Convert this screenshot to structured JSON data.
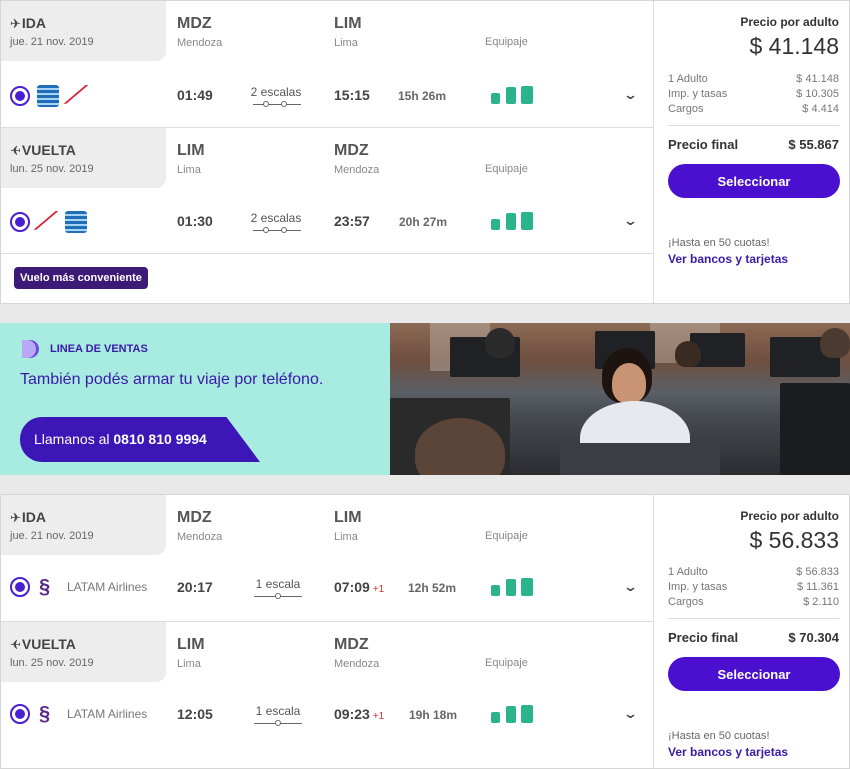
{
  "results": [
    {
      "legs": [
        {
          "direction": "IDA",
          "date": "jue. 21 nov. 2019",
          "origin_code": "MDZ",
          "origin_city": "Mendoza",
          "dest_code": "LIM",
          "dest_city": "Lima",
          "baggage_label": "Equipaje",
          "depart": "01:49",
          "stops": "2 escalas",
          "arrive": "15:15",
          "arrive_plus": "",
          "duration": "15h 26m",
          "airline_name": ""
        },
        {
          "direction": "VUELTA",
          "date": "lun. 25 nov. 2019",
          "origin_code": "LIM",
          "origin_city": "Lima",
          "dest_code": "MDZ",
          "dest_city": "Mendoza",
          "baggage_label": "Equipaje",
          "depart": "01:30",
          "stops": "2 escalas",
          "arrive": "23:57",
          "arrive_plus": "",
          "duration": "20h 27m",
          "airline_name": ""
        }
      ],
      "badge": "Vuelo más conveniente",
      "price": {
        "per_adult_label": "Precio por adulto",
        "per_adult": "$ 41.148",
        "rows": [
          {
            "label": "1 Adulto",
            "value": "$ 41.148"
          },
          {
            "label": "Imp. y tasas",
            "value": "$ 10.305"
          },
          {
            "label": "Cargos",
            "value": "$ 4.414"
          }
        ],
        "final_label": "Precio final",
        "final": "$ 55.867",
        "select_label": "Seleccionar",
        "cuotas": "¡Hasta en 50 cuotas!",
        "bancos": "Ver bancos y tarjetas"
      }
    },
    {
      "legs": [
        {
          "direction": "IDA",
          "date": "jue. 21 nov. 2019",
          "origin_code": "MDZ",
          "origin_city": "Mendoza",
          "dest_code": "LIM",
          "dest_city": "Lima",
          "baggage_label": "Equipaje",
          "depart": "20:17",
          "stops": "1 escala",
          "arrive": "07:09",
          "arrive_plus": "+1",
          "duration": "12h 52m",
          "airline_name": "LATAM Airlines"
        },
        {
          "direction": "VUELTA",
          "date": "lun. 25 nov. 2019",
          "origin_code": "LIM",
          "origin_city": "Lima",
          "dest_code": "MDZ",
          "dest_city": "Mendoza",
          "baggage_label": "Equipaje",
          "depart": "12:05",
          "stops": "1 escala",
          "arrive": "09:23",
          "arrive_plus": "+1",
          "duration": "19h 18m",
          "airline_name": "LATAM Airlines"
        }
      ],
      "price": {
        "per_adult_label": "Precio por adulto",
        "per_adult": "$ 56.833",
        "rows": [
          {
            "label": "1 Adulto",
            "value": "$ 56.833"
          },
          {
            "label": "Imp. y tasas",
            "value": "$ 11.361"
          },
          {
            "label": "Cargos",
            "value": "$ 2.110"
          }
        ],
        "final_label": "Precio final",
        "final": "$ 70.304",
        "select_label": "Seleccionar",
        "cuotas": "¡Hasta en 50 cuotas!",
        "bancos": "Ver bancos y tarjetas"
      }
    }
  ],
  "banner": {
    "title": "LINEA DE VENTAS",
    "subtitle": "También podés armar tu viaje por teléfono.",
    "call_prefix": "Llamanos al",
    "phone": "0810 810 9994"
  },
  "colors": {
    "accent": "#4a0fcf",
    "badge": "#3d1a78",
    "baggage": "#2bb38b",
    "banner_bg": "#a8ebe0",
    "next_day": "#d32f2f"
  },
  "icons": {
    "ida": "plane-right-icon",
    "vuelta": "plane-left-icon",
    "expand": "chevron-down-icon",
    "baggage": "luggage-icon"
  }
}
